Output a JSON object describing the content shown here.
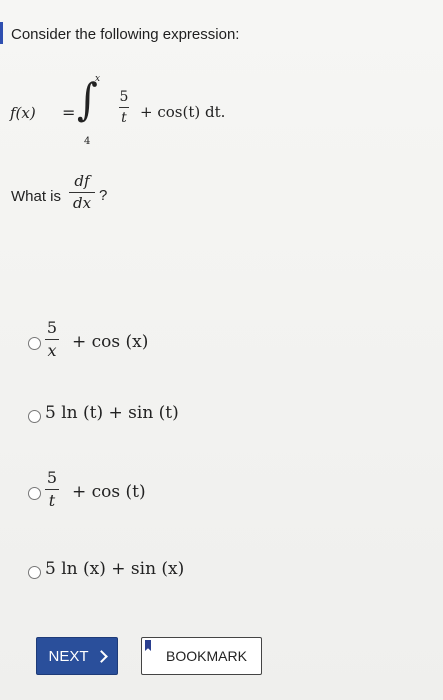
{
  "prompt": "Consider the following expression:",
  "expression": {
    "lhs": "f(x)",
    "equals": "=",
    "integral_sign": "∫",
    "upper_limit": "x",
    "lower_limit": "4",
    "fraction_numerator": "5",
    "fraction_denominator": "t",
    "remainder": "+ cos(t) dt."
  },
  "question": {
    "label": "What is",
    "numerator": "df",
    "denominator": "dx",
    "end": "?"
  },
  "options": [
    {
      "numerator": "5",
      "denominator": "x",
      "text": "+ cos (x)"
    },
    {
      "text": "5 ln (t) + sin (t)"
    },
    {
      "numerator": "5",
      "denominator": "t",
      "text": "+ cos (t)"
    },
    {
      "text": "5 ln (x) + sin (x)"
    }
  ],
  "buttons": {
    "next_label": "NEXT",
    "bookmark_label": "BOOKMARK"
  },
  "colors": {
    "accent": "#2f4fb0",
    "next_bg": "#2a4f9b",
    "bookmark_icon": "#2a3f8f"
  },
  "icons": {
    "next": "chevron-right-icon",
    "bookmark": "bookmark-icon"
  }
}
